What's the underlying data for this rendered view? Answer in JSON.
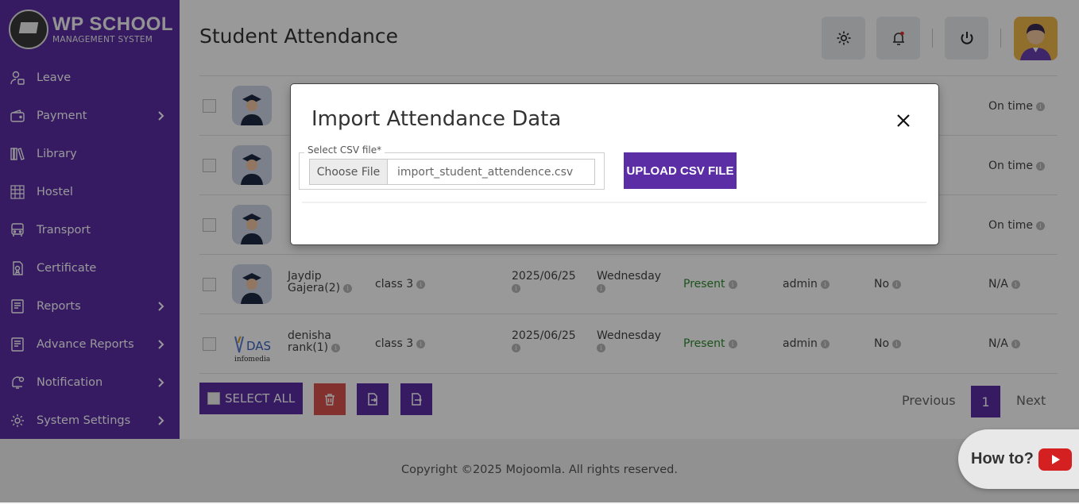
{
  "brand": {
    "title": "WP SCHOOL",
    "subtitle": "MANAGEMENT SYSTEM"
  },
  "sidebar": {
    "items": [
      {
        "label": "Leave",
        "icon": "leave-icon",
        "has_chevron": false
      },
      {
        "label": "Payment",
        "icon": "wallet-icon",
        "has_chevron": true
      },
      {
        "label": "Library",
        "icon": "library-icon",
        "has_chevron": false
      },
      {
        "label": "Hostel",
        "icon": "hostel-icon",
        "has_chevron": false
      },
      {
        "label": "Transport",
        "icon": "bus-icon",
        "has_chevron": false
      },
      {
        "label": "Certificate",
        "icon": "certificate-icon",
        "has_chevron": false
      },
      {
        "label": "Reports",
        "icon": "report-icon",
        "has_chevron": true
      },
      {
        "label": "Advance Reports",
        "icon": "advance-report-icon",
        "has_chevron": true
      },
      {
        "label": "Notification",
        "icon": "notification-icon",
        "has_chevron": true
      },
      {
        "label": "System Settings",
        "icon": "gear-icon",
        "has_chevron": true
      }
    ]
  },
  "header": {
    "title": "Student Attendance"
  },
  "table": {
    "rows": [
      {
        "status": "On time"
      },
      {
        "status": "On time"
      },
      {
        "status": "On time"
      },
      {
        "name": "Jaydip Gajera(2)",
        "class": "class 3",
        "date": "2025/06/25",
        "day": "Wednesday",
        "attendance": "Present",
        "by": "admin",
        "late": "No",
        "status": "N/A"
      },
      {
        "name": "denisha rank(1)",
        "class": "class 3",
        "date": "2025/06/25",
        "day": "Wednesday",
        "attendance": "Present",
        "by": "admin",
        "late": "No",
        "status": "N/A"
      }
    ]
  },
  "actions": {
    "select_all": "SELECT ALL"
  },
  "pagination": {
    "previous": "Previous",
    "current": "1",
    "next": "Next"
  },
  "footer": {
    "copyright": "Copyright ©2025 Mojoomla. All rights reserved."
  },
  "howto": {
    "label": "How to?"
  },
  "modal": {
    "title": "Import Attendance Data",
    "field_legend": "Select CSV file*",
    "choose_file": "Choose File",
    "file_name": "import_student_attendence.csv",
    "upload_button": "UPLOAD CSV FILE"
  },
  "colors": {
    "sidebar": "#5b2ea6",
    "accent": "#5b2ea6",
    "present": "#2e8b2e",
    "danger": "#d9534f",
    "youtube": "#d42020"
  }
}
